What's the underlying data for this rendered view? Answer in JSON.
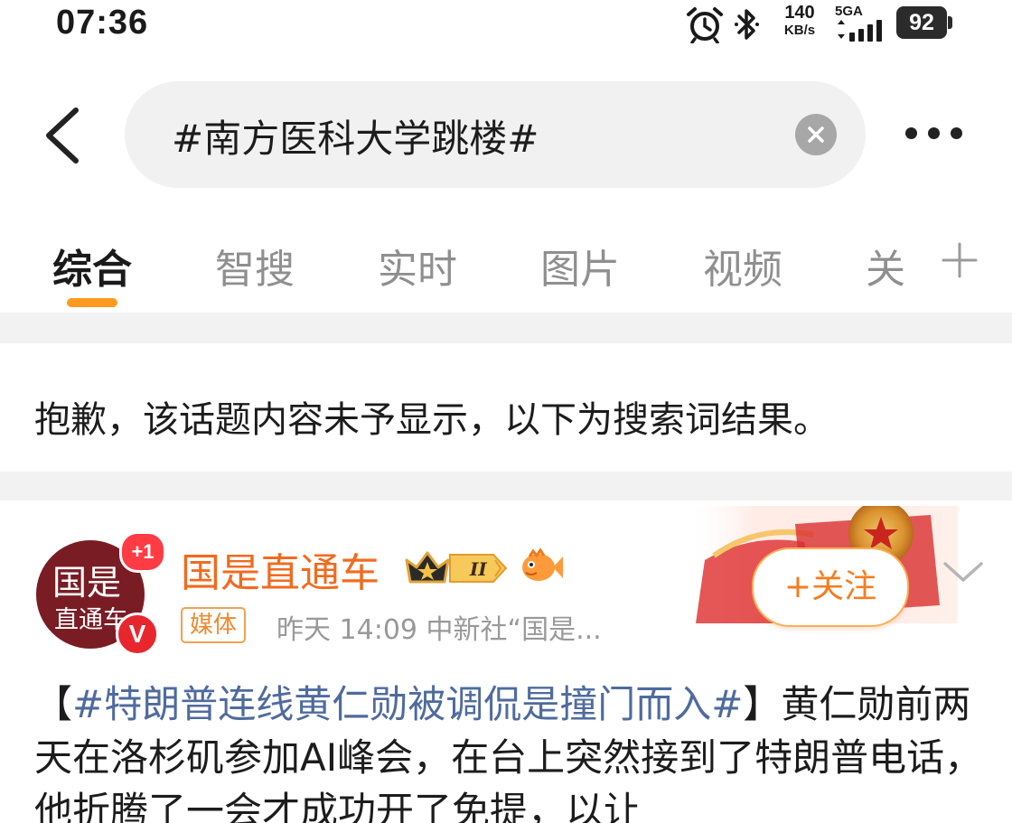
{
  "status_bar": {
    "time": "07:36",
    "speed_value": "140",
    "speed_unit": "KB/s",
    "network": "5GA",
    "battery": "92",
    "icons": [
      "alarm-icon",
      "bluetooth-icon",
      "signal-icon",
      "battery-icon"
    ]
  },
  "search": {
    "query": "#南方医科大学跳楼#",
    "icons": [
      "back-arrow-icon",
      "clear-icon",
      "more-icon"
    ]
  },
  "tabs": {
    "items": [
      {
        "label": "综合",
        "active": true
      },
      {
        "label": "智搜"
      },
      {
        "label": "实时"
      },
      {
        "label": "图片"
      },
      {
        "label": "视频"
      },
      {
        "label": "关"
      }
    ],
    "add_icon": "plus-icon",
    "indicator_color": "#ff9a1f"
  },
  "notice": "抱歉，该话题内容未予显示，以下为搜索词结果。",
  "post": {
    "avatar_line1": "国是",
    "avatar_line2": "直通车",
    "avatar_badge": "+1",
    "verified_mark": "V",
    "author": "国是直通车",
    "level": "II",
    "media_tag": "媒体",
    "meta": "昨天 14:09  中新社“国是...",
    "follow_label": "+关注",
    "bracket_open": "【",
    "hashtag": "#特朗普连线黄仁勋被调侃是撞门而入#",
    "bracket_close": "】",
    "text": "黄仁勋前两天在洛杉矶参加AI峰会，在台上突然接到了特朗普电话，他折腾了一会才成功开了免提，以让",
    "colors": {
      "author": "#f06b1f",
      "hashtag": "#4e6b9e",
      "follow": "#f47d1f"
    }
  }
}
